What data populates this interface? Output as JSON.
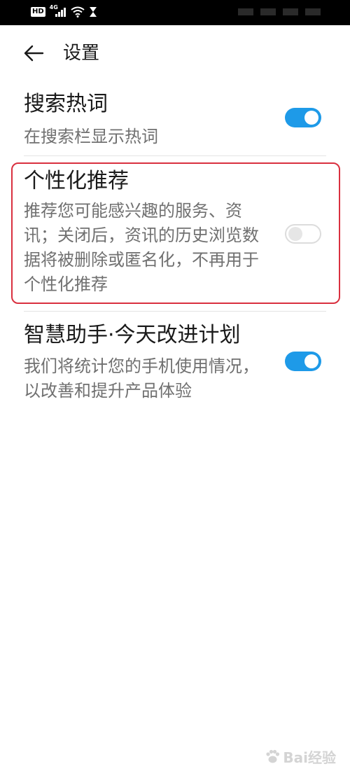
{
  "status_bar": {
    "hd_label": "HD",
    "network_label": "4G",
    "icons": [
      "hd-icon",
      "signal-icon",
      "wifi-icon",
      "hourglass-icon"
    ]
  },
  "header": {
    "back_icon": "arrow-left-icon",
    "title": "设置"
  },
  "settings": [
    {
      "title": "搜索热词",
      "description": "在搜索栏显示热词",
      "enabled": true
    },
    {
      "title": "个性化推荐",
      "description": "推荐您可能感兴趣的服务、资讯；关闭后，资讯的历史浏览数据将被删除或匿名化，不再用于个性化推荐",
      "enabled": false
    },
    {
      "title": "智慧助手·今天改进计划",
      "description": "我们将统计您的手机使用情况，以改善和提升产品体验",
      "enabled": true
    }
  ],
  "colors": {
    "toggle_on": "#1e9ae8",
    "toggle_off_border": "#dcdcdc",
    "highlight": "#d9303f",
    "title_text": "#1a1a1a",
    "desc_text": "#707070"
  },
  "watermark": {
    "text": "Bai经验",
    "icon": "paw-icon"
  }
}
